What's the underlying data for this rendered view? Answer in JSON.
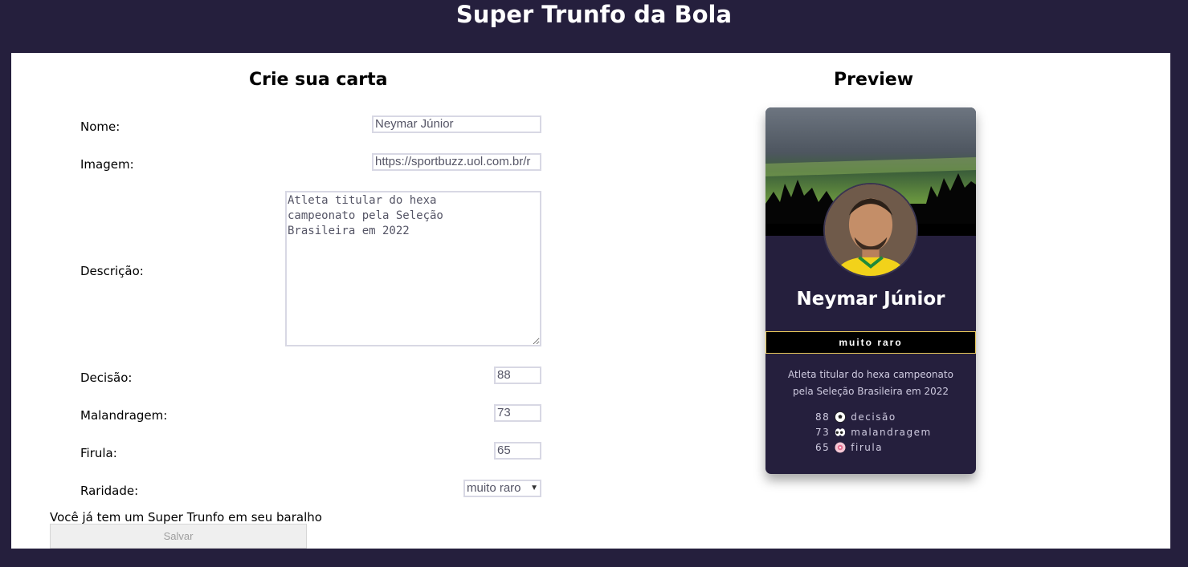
{
  "app": {
    "title": "Super Trunfo da Bola"
  },
  "form": {
    "title": "Crie sua carta",
    "name_label": "Nome:",
    "name_value": "Neymar Júnior",
    "image_label": "Imagem:",
    "image_value": "https://sportbuzz.uol.com.br/r",
    "description_label": "Descrição:",
    "description_value": "Atleta titular do hexa\ncampeonato pela Seleção\nBrasileira em 2022",
    "attr1_label": "Decisão:",
    "attr1_value": "88",
    "attr2_label": "Malandragem:",
    "attr2_value": "73",
    "attr3_label": "Firula:",
    "attr3_value": "65",
    "rarity_label": "Raridade:",
    "rarity_value": "muito raro",
    "notice": "Você já tem um Super Trunfo em seu baralho",
    "save_label": "Salvar"
  },
  "preview": {
    "title": "Preview",
    "card": {
      "name": "Neymar Júnior",
      "rarity": "muito raro",
      "description": "Atleta titular do hexa campeonato pela Seleção Brasileira em 2022",
      "stats": [
        {
          "value": "88",
          "icon": "soccer-ball-icon",
          "label": "decisão"
        },
        {
          "value": "73",
          "icon": "eyes-icon",
          "label": "malandragem"
        },
        {
          "value": "65",
          "icon": "firula-icon",
          "label": "firula"
        }
      ]
    }
  },
  "colors": {
    "page_background": "#251f3d",
    "card_background": "#251f3d",
    "rarity_border": "#e8c85a"
  }
}
